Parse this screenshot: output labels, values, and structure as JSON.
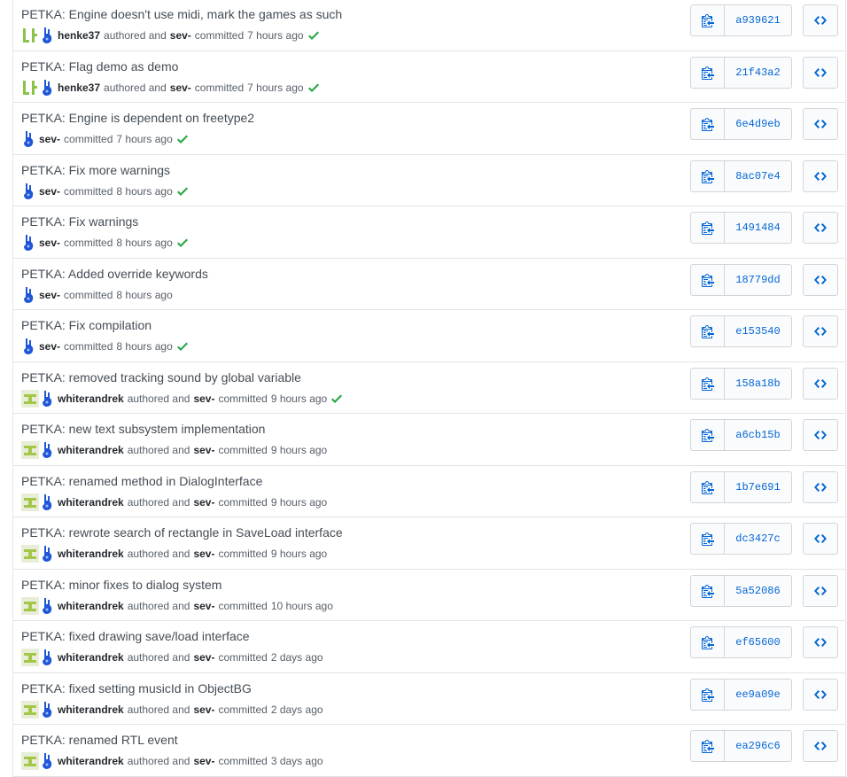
{
  "colors": {
    "link": "#0366d6",
    "success": "#28a745",
    "border": "#e1e4e8",
    "muted": "#586069"
  },
  "commits": [
    {
      "title": "PETKA: Engine doesn't use midi, mark the games as such",
      "author": "henke37",
      "authored_label": "authored and",
      "committer": "sev-",
      "committed_label": "committed",
      "time": "7 hours ago",
      "status": "success",
      "sha": "a939621",
      "author_avatar": "henke37-avatar"
    },
    {
      "title": "PETKA: Flag demo as demo",
      "author": "henke37",
      "authored_label": "authored and",
      "committer": "sev-",
      "committed_label": "committed",
      "time": "7 hours ago",
      "status": "success",
      "sha": "21f43a2",
      "author_avatar": "henke37-avatar"
    },
    {
      "title": "PETKA: Engine is dependent on freetype2",
      "author": "",
      "authored_label": "",
      "committer": "sev-",
      "committed_label": "committed",
      "time": "7 hours ago",
      "status": "success",
      "sha": "6e4d9eb",
      "author_avatar": ""
    },
    {
      "title": "PETKA: Fix more warnings",
      "author": "",
      "authored_label": "",
      "committer": "sev-",
      "committed_label": "committed",
      "time": "8 hours ago",
      "status": "success",
      "sha": "8ac07e4",
      "author_avatar": ""
    },
    {
      "title": "PETKA: Fix warnings",
      "author": "",
      "authored_label": "",
      "committer": "sev-",
      "committed_label": "committed",
      "time": "8 hours ago",
      "status": "success",
      "sha": "1491484",
      "author_avatar": ""
    },
    {
      "title": "PETKA: Added override keywords",
      "author": "",
      "authored_label": "",
      "committer": "sev-",
      "committed_label": "committed",
      "time": "8 hours ago",
      "status": "",
      "sha": "18779dd",
      "author_avatar": ""
    },
    {
      "title": "PETKA: Fix compilation",
      "author": "",
      "authored_label": "",
      "committer": "sev-",
      "committed_label": "committed",
      "time": "8 hours ago",
      "status": "success",
      "sha": "e153540",
      "author_avatar": ""
    },
    {
      "title": "PETKA: removed tracking sound by global variable",
      "author": "whiterandrek",
      "authored_label": "authored and",
      "committer": "sev-",
      "committed_label": "committed",
      "time": "9 hours ago",
      "status": "success",
      "sha": "158a18b",
      "author_avatar": "whiterandrek-avatar"
    },
    {
      "title": "PETKA: new text subsystem implementation",
      "author": "whiterandrek",
      "authored_label": "authored and",
      "committer": "sev-",
      "committed_label": "committed",
      "time": "9 hours ago",
      "status": "",
      "sha": "a6cb15b",
      "author_avatar": "whiterandrek-avatar"
    },
    {
      "title": "PETKA: renamed method in DialogInterface",
      "author": "whiterandrek",
      "authored_label": "authored and",
      "committer": "sev-",
      "committed_label": "committed",
      "time": "9 hours ago",
      "status": "",
      "sha": "1b7e691",
      "author_avatar": "whiterandrek-avatar"
    },
    {
      "title": "PETKA: rewrote search of rectangle in SaveLoad interface",
      "author": "whiterandrek",
      "authored_label": "authored and",
      "committer": "sev-",
      "committed_label": "committed",
      "time": "9 hours ago",
      "status": "",
      "sha": "dc3427c",
      "author_avatar": "whiterandrek-avatar"
    },
    {
      "title": "PETKA: minor fixes to dialog system",
      "author": "whiterandrek",
      "authored_label": "authored and",
      "committer": "sev-",
      "committed_label": "committed",
      "time": "10 hours ago",
      "status": "",
      "sha": "5a52086",
      "author_avatar": "whiterandrek-avatar"
    },
    {
      "title": "PETKA: fixed drawing save/load interface",
      "author": "whiterandrek",
      "authored_label": "authored and",
      "committer": "sev-",
      "committed_label": "committed",
      "time": "2 days ago",
      "status": "",
      "sha": "ef65600",
      "author_avatar": "whiterandrek-avatar"
    },
    {
      "title": "PETKA: fixed setting musicId in ObjectBG",
      "author": "whiterandrek",
      "authored_label": "authored and",
      "committer": "sev-",
      "committed_label": "committed",
      "time": "2 days ago",
      "status": "",
      "sha": "ee9a09e",
      "author_avatar": "whiterandrek-avatar"
    },
    {
      "title": "PETKA: renamed RTL event",
      "author": "whiterandrek",
      "authored_label": "authored and",
      "committer": "sev-",
      "committed_label": "committed",
      "time": "3 days ago",
      "status": "",
      "sha": "ea296c6",
      "author_avatar": "whiterandrek-avatar"
    }
  ]
}
